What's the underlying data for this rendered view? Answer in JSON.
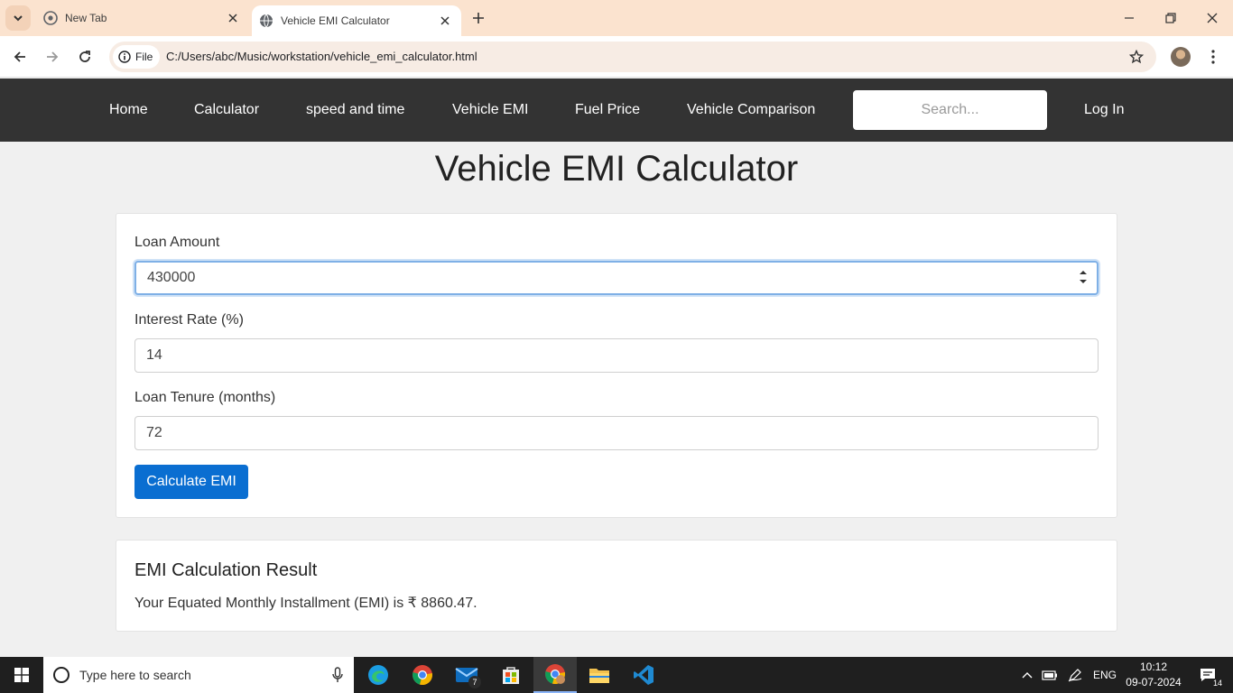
{
  "browser": {
    "tabs": [
      {
        "title": "New Tab",
        "active": false
      },
      {
        "title": "Vehicle EMI Calculator",
        "active": true
      }
    ],
    "chip_label": "File",
    "url": "C:/Users/abc/Music/workstation/vehicle_emi_calculator.html"
  },
  "navbar": {
    "links": [
      "Home",
      "Calculator",
      "speed and time",
      "Vehicle EMI",
      "Fuel Price",
      "Vehicle Comparison"
    ],
    "search_placeholder": "Search...",
    "login_label": "Log In"
  },
  "page": {
    "title": "Vehicle EMI Calculator"
  },
  "form": {
    "loan_amount_label": "Loan Amount",
    "loan_amount_value": "430000",
    "interest_rate_label": "Interest Rate (%)",
    "interest_rate_value": "14",
    "tenure_label": "Loan Tenure (months)",
    "tenure_value": "72",
    "button_label": "Calculate EMI"
  },
  "result": {
    "title": "EMI Calculation Result",
    "text": "Your Equated Monthly Installment (EMI) is ₹ 8860.47."
  },
  "taskbar": {
    "search_placeholder": "Type here to search",
    "mail_badge": "7",
    "language": "ENG",
    "time": "10:12",
    "date": "09-07-2024",
    "notifications": "14"
  },
  "colors": {
    "navbar_bg": "#333333",
    "button_bg": "#0a6ed1",
    "tabbar_bg": "#fbe3cf",
    "page_bg": "#f0f0f0"
  }
}
